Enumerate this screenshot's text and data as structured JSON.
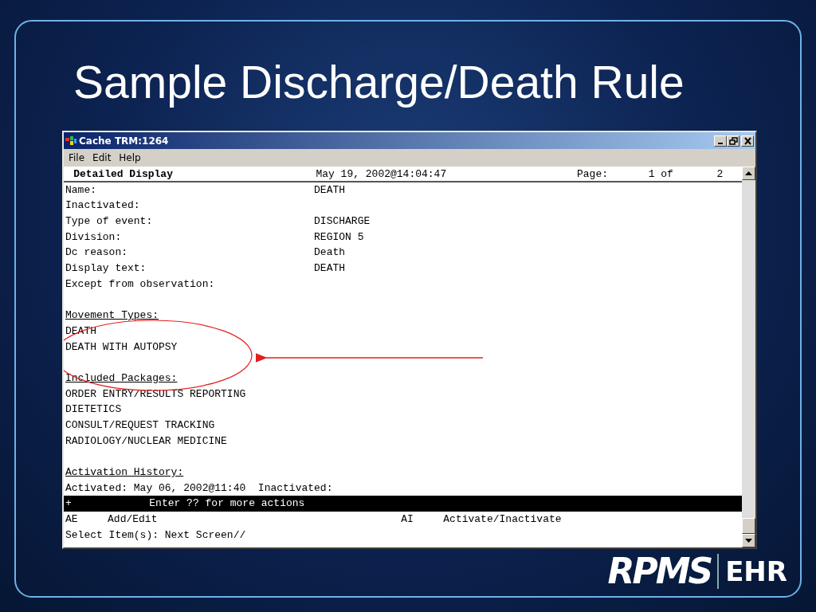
{
  "slide": {
    "title": "Sample Discharge/Death Rule"
  },
  "window": {
    "title": "Cache TRM:1264",
    "menu": [
      "File",
      "Edit",
      "Help"
    ]
  },
  "terminal": {
    "header": {
      "title": "Detailed Display",
      "timestamp": "May 19, 2002@14:04:47",
      "page_label": "Page:",
      "page_current": "1 of",
      "page_total": "2"
    },
    "lines": [
      {
        "kind": "field",
        "label": "Name:",
        "value": "DEATH"
      },
      {
        "kind": "field",
        "label": "Inactivated:"
      },
      {
        "kind": "field",
        "label": "Type of event:",
        "value": "DISCHARGE"
      },
      {
        "kind": "field",
        "label": "Division:",
        "value": "REGION 5"
      },
      {
        "kind": "field",
        "label": "Dc reason:",
        "value": "Death"
      },
      {
        "kind": "field",
        "label": "Display text:",
        "value": "DEATH"
      },
      {
        "kind": "field",
        "label": "Except from observation:"
      },
      {
        "kind": "blank"
      },
      {
        "kind": "heading",
        "text": "Movement Types:"
      },
      {
        "kind": "text",
        "text": "DEATH"
      },
      {
        "kind": "text",
        "text": "DEATH WITH AUTOPSY"
      },
      {
        "kind": "blank"
      },
      {
        "kind": "heading",
        "text": "Included Packages:"
      },
      {
        "kind": "text",
        "text": "ORDER ENTRY/RESULTS REPORTING"
      },
      {
        "kind": "text",
        "text": "DIETETICS"
      },
      {
        "kind": "text",
        "text": "CONSULT/REQUEST TRACKING"
      },
      {
        "kind": "text",
        "text": "RADIOLOGY/NUCLEAR MEDICINE"
      },
      {
        "kind": "blank"
      },
      {
        "kind": "heading",
        "text": "Activation History:"
      },
      {
        "kind": "text",
        "text": "Activated: May 06, 2002@11:40  Inactivated:"
      }
    ],
    "action_bar": {
      "marker": "+",
      "text": "Enter ?? for more actions"
    },
    "actions": [
      {
        "code": "AE",
        "label": "Add/Edit"
      },
      {
        "code": "AI",
        "label": "Activate/Inactivate"
      }
    ],
    "prompt": "Select Item(s): Next Screen//"
  },
  "logo": {
    "primary": "RPMS",
    "secondary": "EHR"
  }
}
